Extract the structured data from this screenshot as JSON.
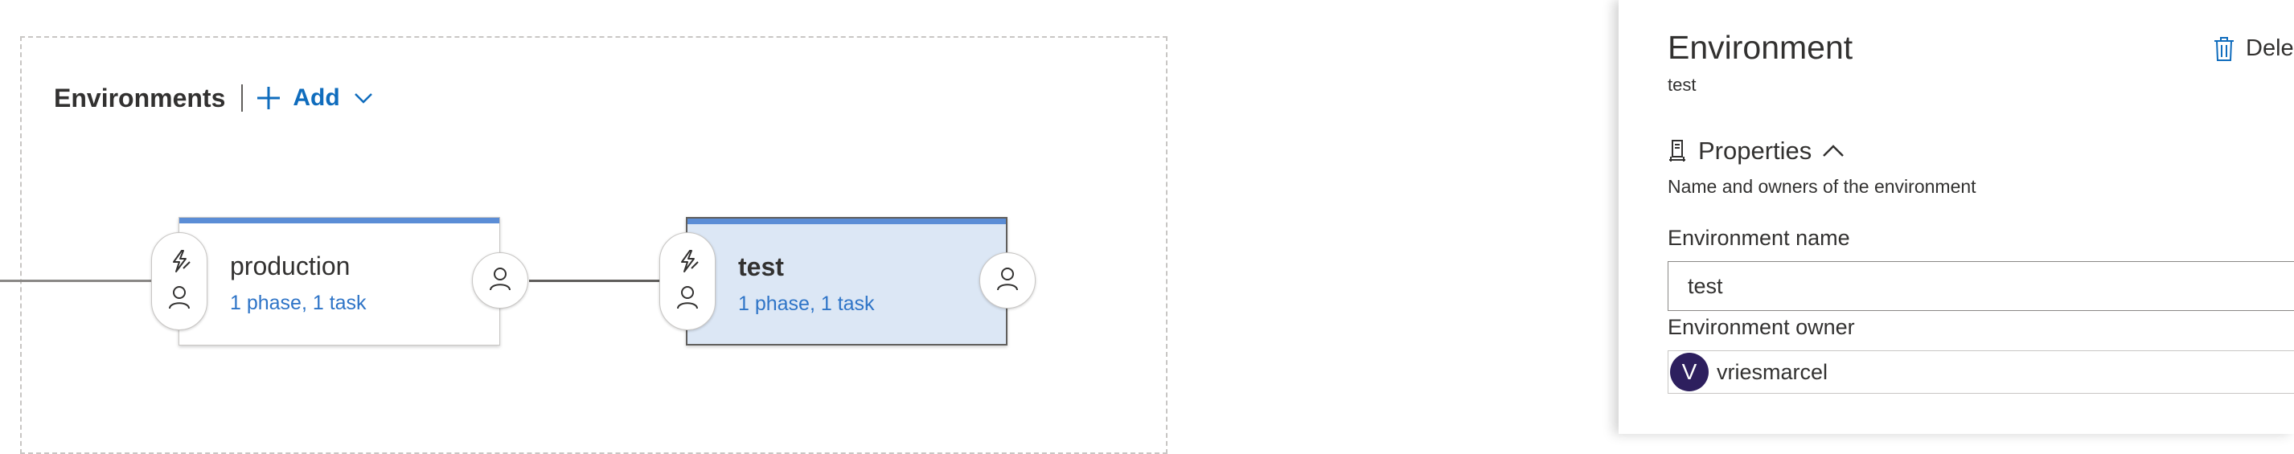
{
  "environments_section": {
    "title": "Environments",
    "add_label": "Add"
  },
  "stages": [
    {
      "name": "production",
      "summary": "1 phase, 1 task",
      "selected": false
    },
    {
      "name": "test",
      "summary": "1 phase, 1 task",
      "selected": true
    }
  ],
  "panel": {
    "title": "Environment",
    "subtitle": "test",
    "delete_label": "Delete",
    "properties_label": "Properties",
    "properties_description": "Name and owners of the environment",
    "name_label": "Environment name",
    "name_value": "test",
    "owner_label": "Environment owner",
    "owner_initial": "V",
    "owner_name": "vriesmarcel"
  },
  "colors": {
    "accent_blue": "#0f6cbd",
    "stage_topbar": "#5b8dd6",
    "selected_card_bg": "#dce7f5",
    "avatar_bg": "#2d1f5e"
  },
  "icons": {
    "add": "plus-icon",
    "dropdown": "chevron-down-icon",
    "pre_deploy_trigger": "lightning-icon",
    "pre_deploy_approver": "person-icon",
    "post_deploy_approver": "person-icon",
    "delete": "trash-icon",
    "properties": "server-icon",
    "collapse": "chevron-up-icon"
  }
}
